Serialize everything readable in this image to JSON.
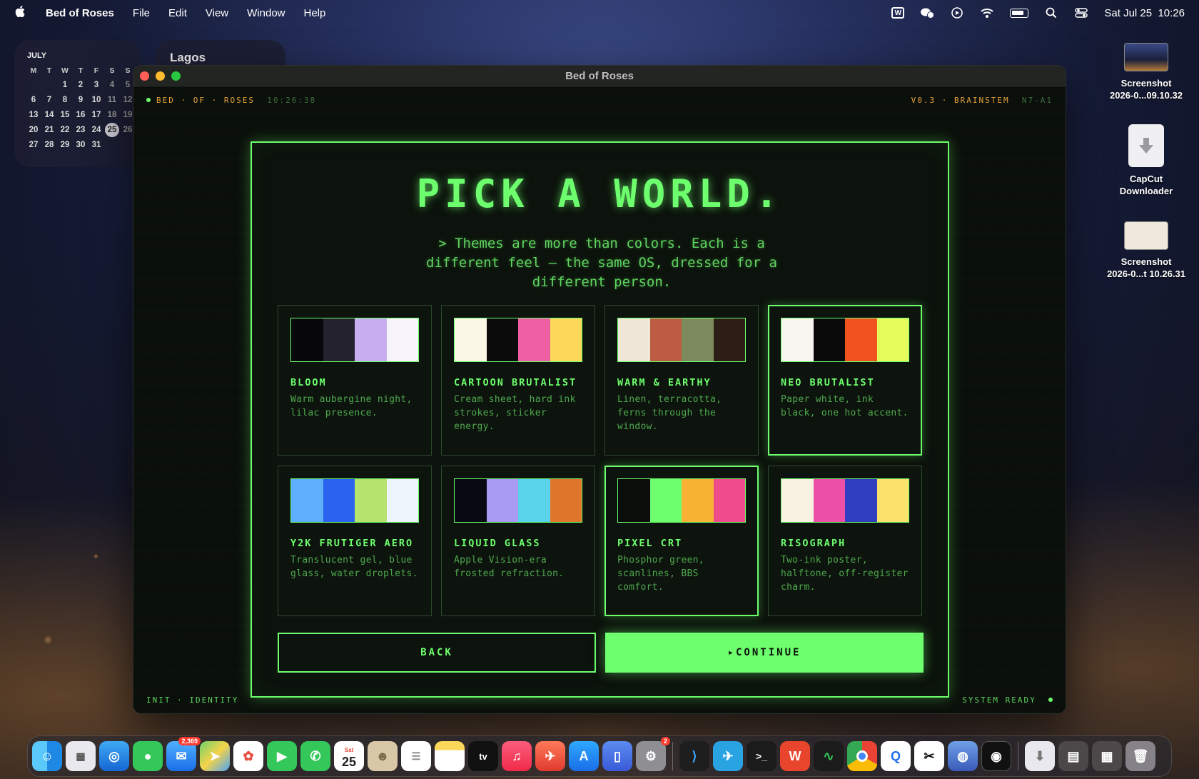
{
  "menubar": {
    "app_name": "Bed of Roses",
    "items": [
      "File",
      "Edit",
      "View",
      "Window",
      "Help"
    ],
    "datetime": "Sat Jul 25  10:26"
  },
  "calendar": {
    "month": "JULY",
    "weekdays": [
      "M",
      "T",
      "W",
      "T",
      "F",
      "S",
      "S"
    ],
    "weeks": [
      [
        "",
        "",
        "1",
        "2",
        "3",
        "4",
        "5"
      ],
      [
        "6",
        "7",
        "8",
        "9",
        "10",
        "11",
        "12"
      ],
      [
        "13",
        "14",
        "15",
        "16",
        "17",
        "18",
        "19"
      ],
      [
        "20",
        "21",
        "22",
        "23",
        "24",
        "25",
        "26"
      ],
      [
        "27",
        "28",
        "29",
        "30",
        "31",
        "",
        ""
      ]
    ],
    "today": "25"
  },
  "weather": {
    "city": "Lagos"
  },
  "desktop": [
    {
      "label_line1": "Screenshot",
      "label_line2": "2026-0...09.10.32"
    },
    {
      "label_line1": "CapCut",
      "label_line2": "Downloader"
    },
    {
      "label_line1": "Screenshot",
      "label_line2": "2026-0...t 10.26.31"
    }
  ],
  "window": {
    "title": "Bed of Roses",
    "topbar_left": "BED · OF · ROSES",
    "topbar_time": "10:26:38",
    "topbar_version": "V0.3 · BRAINSTEM",
    "topbar_code": "N7-A1",
    "heading": "PICK A WORLD.",
    "subheading": "> Themes are more than colors. Each is a different feel — the same OS, dressed for a different person.",
    "themes": [
      {
        "name": "BLOOM",
        "desc": "Warm aubergine night, lilac presence.",
        "colors": [
          "#07070b",
          "#25222f",
          "#c6aef0",
          "#f7f5fb"
        ]
      },
      {
        "name": "CARTOON BRUTALIST",
        "desc": "Cream sheet, hard ink strokes, sticker energy.",
        "colors": [
          "#fbf7e6",
          "#0b0b0b",
          "#ef5fa3",
          "#fcd85a"
        ]
      },
      {
        "name": "WARM & EARTHY",
        "desc": "Linen, terracotta, ferns through the window.",
        "colors": [
          "#efe6d7",
          "#bd5b43",
          "#7d8a5d",
          "#2e1d16"
        ]
      },
      {
        "name": "NEO BRUTALIST",
        "desc": "Paper white, ink black, one hot accent.",
        "colors": [
          "#f7f6f1",
          "#0a0a0a",
          "#f2521f",
          "#e6fb5c"
        ]
      },
      {
        "name": "Y2K FRUTIGER AERO",
        "desc": "Translucent gel, blue glass, water droplets.",
        "colors": [
          "#5eaefb",
          "#2b63ee",
          "#b6e36d",
          "#eef4fc"
        ]
      },
      {
        "name": "LIQUID GLASS",
        "desc": "Apple Vision-era frosted refraction.",
        "colors": [
          "#070a10",
          "#a99bf4",
          "#59d3ea",
          "#e0762a"
        ]
      },
      {
        "name": "PIXEL CRT",
        "desc": "Phosphor green, scanlines, BBS comfort.",
        "colors": [
          "#0a0d0a",
          "#6dff6d",
          "#f8b234",
          "#ef4c8c"
        ]
      },
      {
        "name": "RISOGRAPH",
        "desc": "Two-ink poster, halftone, off-register charm.",
        "colors": [
          "#f7f2e2",
          "#ec4fa8",
          "#2f3fc0",
          "#fbe26d"
        ]
      }
    ],
    "back_label": "BACK",
    "continue_label": "▸CONTINUE",
    "footer_left": "INIT · IDENTITY",
    "footer_right": "SYSTEM READY"
  },
  "dock": {
    "mail_badge": "2,369",
    "settings_badge": "2",
    "calendar_day": "25",
    "calendar_dow": "Sat",
    "tv_label": "tv"
  },
  "colors": {
    "accent": "#6dff6d",
    "amber": "#e5a13a",
    "panel_bg": "#0c120c"
  }
}
